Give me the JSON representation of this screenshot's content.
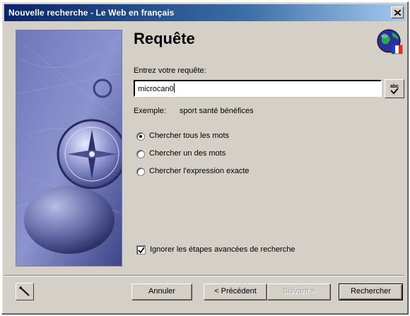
{
  "window": {
    "title": "Nouvelle recherche - Le Web en français"
  },
  "content": {
    "heading": "Requête",
    "query_label": "Entrez votre requête:",
    "query_value": "microcan0",
    "example_label": "Exemple:",
    "example_text": "sport santé bénéfices"
  },
  "options": {
    "search_modes": [
      {
        "label": "Chercher tous les mots",
        "selected": true
      },
      {
        "label": "Chercher un des mots",
        "selected": false
      },
      {
        "label": "Chercher l'expression exacte",
        "selected": false
      }
    ],
    "skip_advanced": {
      "label": "Ignorer les étapes avancées de recherche",
      "checked": true
    }
  },
  "buttons": {
    "cancel": "Annuler",
    "previous": "< Précédent",
    "next": "Suivant >",
    "search": "Rechercher"
  },
  "icons": {
    "globe": "globe-flag-icon",
    "spell": "spell-check-icon",
    "tool": "magic-wand-icon",
    "close": "close-icon"
  },
  "colors": {
    "title_gradient_start": "#0a246a",
    "title_gradient_end": "#a6caf0",
    "face": "#d4d0c8"
  }
}
